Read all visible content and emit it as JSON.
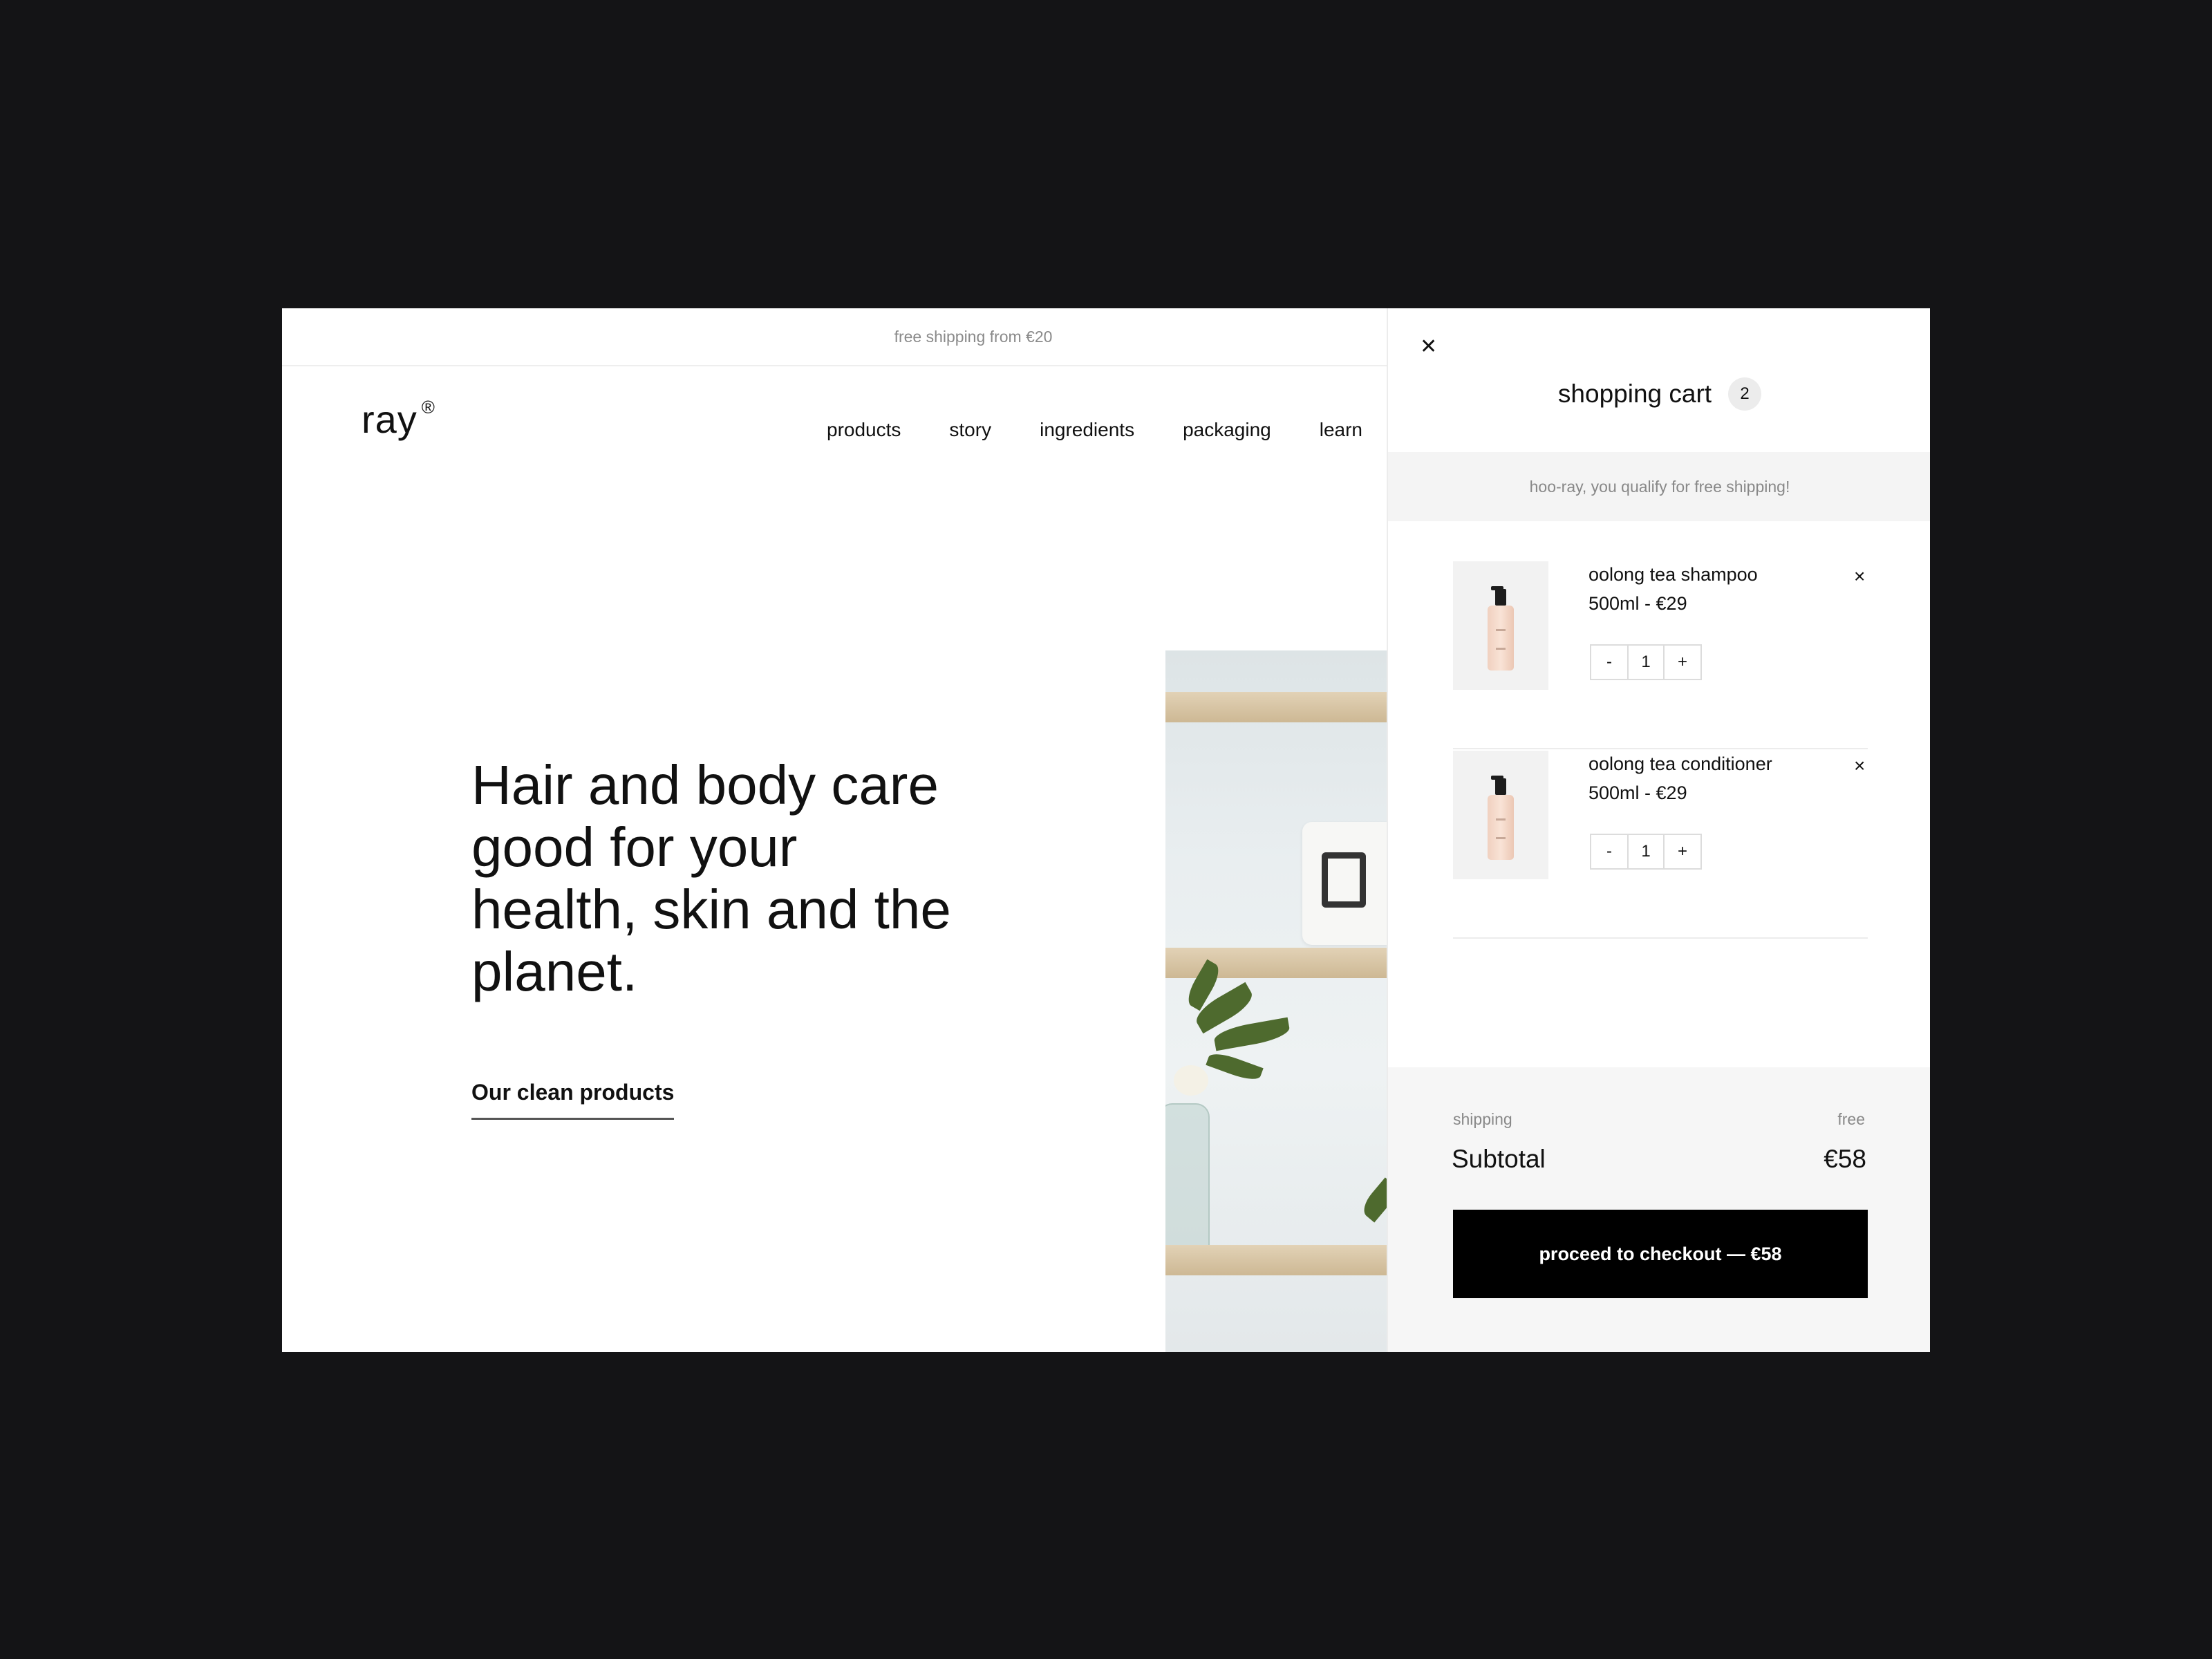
{
  "promo": {
    "text": "free shipping from €20"
  },
  "brand": {
    "name": "ray",
    "mark": "®"
  },
  "nav": {
    "items": [
      "products",
      "story",
      "ingredients",
      "packaging",
      "learn"
    ]
  },
  "hero": {
    "title": "Hair and body care good for your health, skin and the planet.",
    "cta": "Our clean products"
  },
  "cart": {
    "close_icon": "close-icon",
    "title": "shopping cart",
    "count": "2",
    "free_shipping_msg": "hoo-ray, you qualify for free shipping!",
    "items": [
      {
        "name": "oolong tea shampoo",
        "price": "500ml - €29",
        "qty": "1",
        "minus": "-",
        "plus": "+",
        "remove": "×"
      },
      {
        "name": "oolong tea conditioner",
        "price": "500ml - €29",
        "qty": "1",
        "minus": "-",
        "plus": "+",
        "remove": "×"
      }
    ],
    "shipping_label": "shipping",
    "shipping_value": "free",
    "subtotal_label": "Subtotal",
    "subtotal_value": "€58",
    "checkout_label": "proceed to checkout — €58"
  },
  "colors": {
    "backdrop": "#141416",
    "button": "#000000",
    "panel_footer": "#f6f6f6"
  }
}
